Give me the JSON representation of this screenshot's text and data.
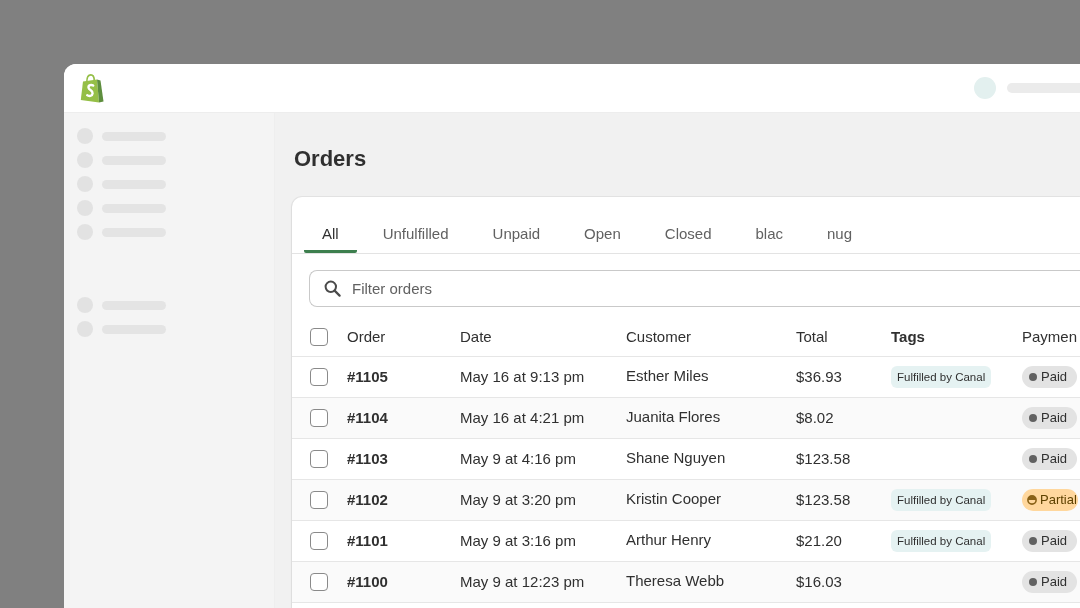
{
  "page": {
    "title": "Orders"
  },
  "tabs": [
    {
      "label": "All",
      "selected": true
    },
    {
      "label": "Unfulfilled",
      "selected": false
    },
    {
      "label": "Unpaid",
      "selected": false
    },
    {
      "label": "Open",
      "selected": false
    },
    {
      "label": "Closed",
      "selected": false
    },
    {
      "label": "blac",
      "selected": false
    },
    {
      "label": "nug",
      "selected": false
    }
  ],
  "search": {
    "placeholder": "Filter orders"
  },
  "table": {
    "select_all": {
      "checked": false
    },
    "columns": [
      "Order",
      "Date",
      "Customer",
      "Total",
      "Tags",
      "Paymen"
    ],
    "rows": [
      {
        "checked": false,
        "order": "#1105",
        "date": "May 16 at 9:13 pm",
        "customer": "Esther Miles",
        "total": "$36.93",
        "tags": [
          "Fulfilled by Canal"
        ],
        "payment": {
          "label": "Paid",
          "kind": "paid"
        }
      },
      {
        "checked": false,
        "order": "#1104",
        "date": "May 16 at 4:21 pm",
        "customer": "Juanita Flores",
        "total": "$8.02",
        "payment": {
          "label": "Paid",
          "kind": "paid"
        }
      },
      {
        "checked": false,
        "order": "#1103",
        "date": "May 9 at 4:16 pm",
        "customer": "Shane Nguyen",
        "total": "$123.58",
        "payment": {
          "label": "Paid",
          "kind": "paid"
        }
      },
      {
        "checked": false,
        "order": "#1102",
        "date": "May 9 at 3:20 pm",
        "customer": "Kristin Cooper",
        "total": "$123.58",
        "tags": [
          "Fulfilled by Canal"
        ],
        "payment": {
          "label": "Partial",
          "kind": "partial"
        }
      },
      {
        "checked": false,
        "order": "#1101",
        "date": "May 9 at 3:16 pm",
        "customer": "Arthur Henry",
        "total": "$21.20",
        "tags": [
          "Fulfilled by Canal"
        ],
        "payment": {
          "label": "Paid",
          "kind": "paid"
        }
      },
      {
        "checked": false,
        "order": "#1100",
        "date": "May 9 at 12:23 pm",
        "customer": "Theresa Webb",
        "total": "$16.03",
        "payment": {
          "label": "Paid",
          "kind": "paid"
        }
      }
    ]
  }
}
